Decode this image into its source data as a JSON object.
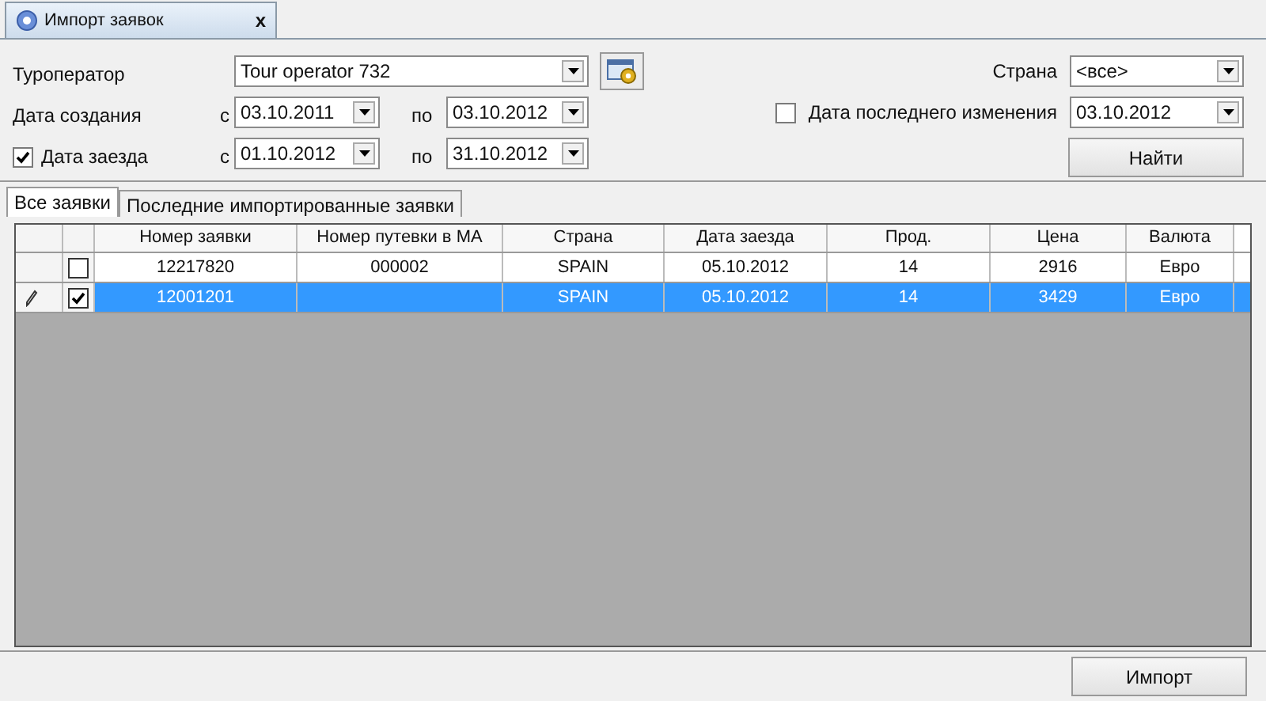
{
  "document_tab": {
    "title": "Импорт заявок",
    "close": "x"
  },
  "filters": {
    "tour_operator": {
      "label": "Туроператор",
      "value": "Tour operator 732"
    },
    "created": {
      "label": "Дата создания",
      "from_label": "с",
      "from": "03.10.2011",
      "to_label": "по",
      "to": "03.10.2012"
    },
    "arrival": {
      "label": "Дата заезда",
      "checked": true,
      "from_label": "с",
      "from": "01.10.2012",
      "to_label": "по",
      "to": "31.10.2012"
    },
    "country": {
      "label": "Страна",
      "value": "<все>"
    },
    "modified": {
      "label": "Дата последнего изменения",
      "checked": false,
      "value": "03.10.2012"
    },
    "find_button": "Найти"
  },
  "tabs": [
    {
      "label": "Все заявки",
      "selected": true
    },
    {
      "label": "Последние импортированные заявки",
      "selected": false
    }
  ],
  "table": {
    "columns": [
      "Номер заявки",
      "Номер путевки в МА",
      "Страна",
      "Дата заезда",
      "Прод.",
      "Цена",
      "Валюта"
    ],
    "rows": [
      {
        "selected": false,
        "checked": false,
        "editing": false,
        "cells": [
          "12217820",
          "000002",
          "SPAIN",
          "05.10.2012",
          "14",
          "2916",
          "Евро"
        ]
      },
      {
        "selected": true,
        "checked": true,
        "editing": true,
        "cells": [
          "12001201",
          "",
          "SPAIN",
          "05.10.2012",
          "14",
          "3429",
          "Евро"
        ]
      }
    ]
  },
  "import_button": "Импорт"
}
